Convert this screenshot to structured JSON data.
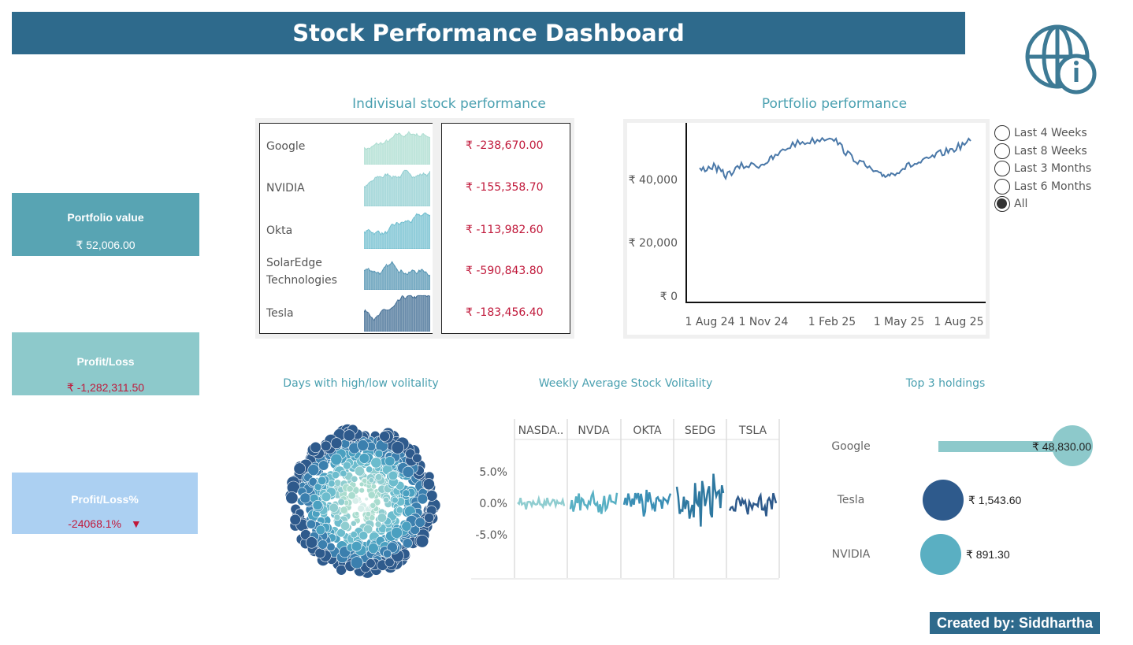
{
  "header": {
    "title": "Stock Performance Dashboard",
    "icon": "globe-info-icon"
  },
  "kpis": {
    "portfolio_value": {
      "label": "Portfolio value",
      "value": "₹ 52,006.00",
      "color": "#58a4b3"
    },
    "profit_loss": {
      "label": "Profit/Loss",
      "value": "₹ -1,282,311.50",
      "color": "#8dc9cb",
      "value_color": "#c0183a"
    },
    "profit_loss_pct": {
      "label": "Profit/Loss%",
      "value": "-24068.1%",
      "arrow": "▼",
      "color": "#acd0f2",
      "value_color": "#c0183a"
    }
  },
  "individual": {
    "title": "Indivisual stock performance",
    "stocks": [
      {
        "name": "Google",
        "pl": "₹ -238,670.00",
        "color": "#a9dccf"
      },
      {
        "name": "NVIDIA",
        "pl": "₹ -155,358.70",
        "color": "#8fcdd0"
      },
      {
        "name": "Okta",
        "pl": "₹ -113,982.60",
        "color": "#6cbccd"
      },
      {
        "name": "SolarEdge Technologies",
        "pl": "₹ -590,843.80",
        "color": "#4f91b0"
      },
      {
        "name": "Tesla",
        "pl": "₹ -183,456.40",
        "color": "#3b6890"
      }
    ]
  },
  "portfolio": {
    "title": "Portfolio performance",
    "y_ticks": [
      "₹ 40,000",
      "₹ 20,000",
      "₹ 0"
    ],
    "x_ticks": [
      "1 Aug 24",
      "1 Nov 24",
      "1 Feb 25",
      "1 May 25",
      "1 Aug 25"
    ],
    "line_color": "#4a78a8"
  },
  "period_filter": {
    "options": [
      "Last 4 Weeks",
      "Last 8 Weeks",
      "Last 3 Months",
      "Last 6 Months",
      "All"
    ],
    "selected": "All"
  },
  "bubble": {
    "title": "Days with high/low volitality"
  },
  "volatility": {
    "title": "Weekly Average Stock Volitality",
    "columns": [
      "NASDA..",
      "NVDA",
      "OKTA",
      "SEDG",
      "TSLA"
    ],
    "y_ticks": [
      "5.0%",
      "0.0%",
      "-5.0%"
    ],
    "colors": [
      "#8fcdd0",
      "#58b0c4",
      "#3b8fb5",
      "#2e78a0",
      "#2e5a8c"
    ]
  },
  "holdings": {
    "title": "Top 3 holdings",
    "items": [
      {
        "name": "Google",
        "value": "₹ 48,830.00",
        "color": "#8dc9cb"
      },
      {
        "name": "Tesla",
        "value": "₹ 1,543.60",
        "color": "#2e5a8c"
      },
      {
        "name": "NVIDIA",
        "value": "₹ 891.30",
        "color": "#5aafc2"
      }
    ]
  },
  "footer": {
    "credit": "Created by: Siddhartha"
  }
}
